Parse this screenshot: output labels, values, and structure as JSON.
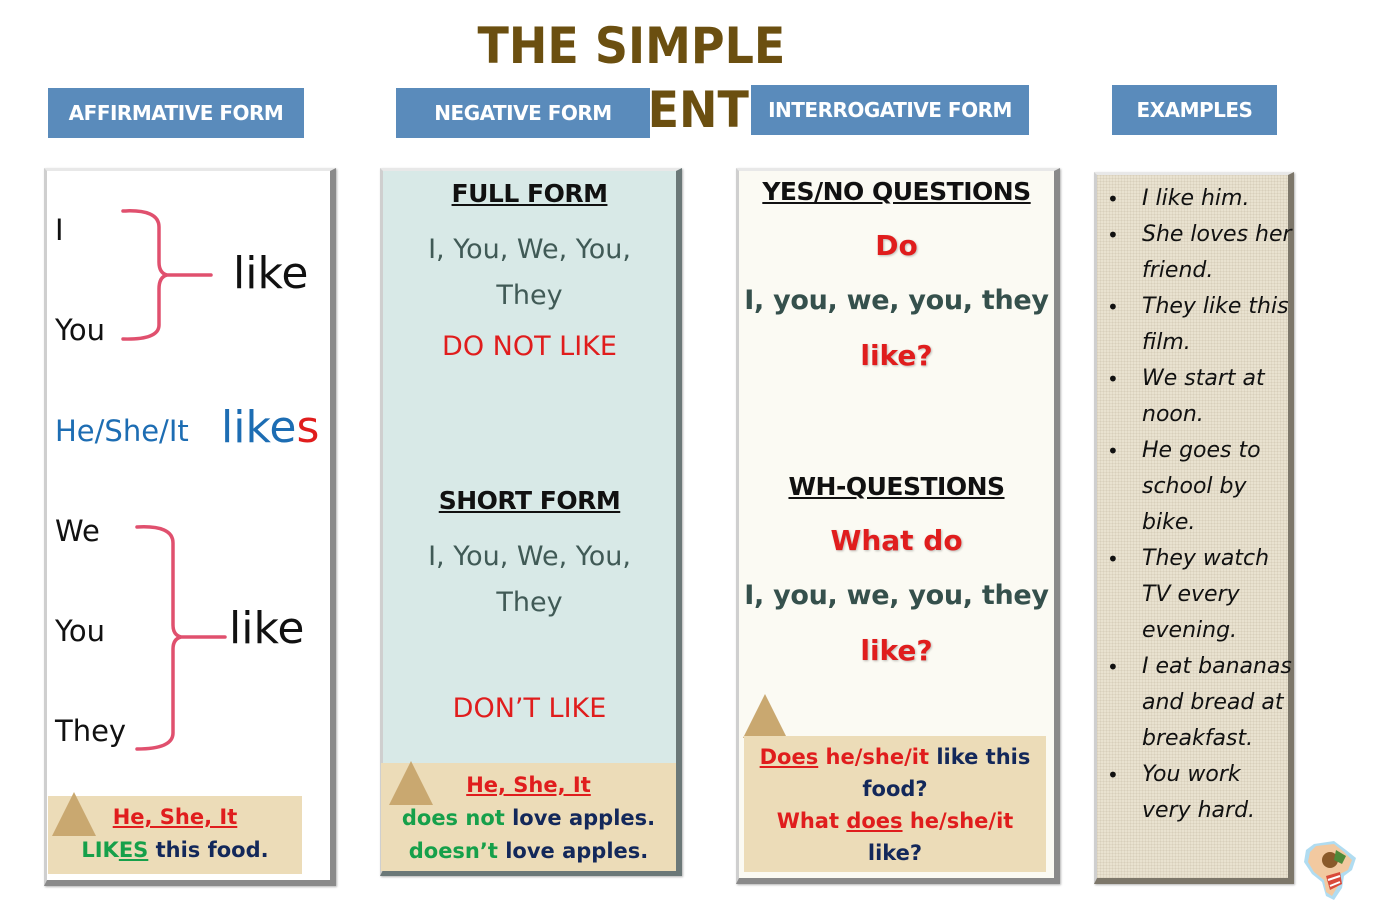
{
  "title": "THE SIMPLE PRESENT",
  "headers": {
    "affirmative": "AFFIRMATIVE FORM",
    "negative": "NEGATIVE FORM",
    "interrogative": "INTERROGATIVE FORM",
    "examples": "EXAMPLES"
  },
  "affirmative": {
    "group1": {
      "pronouns": [
        "I",
        "You"
      ],
      "verb": "like"
    },
    "group2": {
      "pronoun": "He/She/It",
      "verb_stem": "like",
      "verb_suffix": "s"
    },
    "group3": {
      "pronouns": [
        "We",
        "You",
        "They"
      ],
      "verb": "like"
    },
    "note": {
      "subject": "He, She, It",
      "verb_stem": "LIK",
      "verb_suffix": "ES",
      "rest": "this food."
    }
  },
  "negative": {
    "full_form": {
      "heading": "FULL FORM",
      "pronouns_line1": "I, You, We, You,",
      "pronouns_line2": "They",
      "verb": "DO NOT LIKE"
    },
    "short_form": {
      "heading": "SHORT FORM",
      "pronouns_line1": "I, You, We, You,",
      "pronouns_line2": "They",
      "verb": "DON’T LIKE"
    },
    "note": {
      "subject": "He, She, It",
      "line1_aux": "does not",
      "line1_rest": "love apples.",
      "line2_aux": "doesn’t",
      "line2_rest": "love apples."
    }
  },
  "interrogative": {
    "yes_no": {
      "heading": "YES/NO QUESTIONS",
      "aux": "Do",
      "pronouns": "I, you, we, you, they",
      "verb": "like?"
    },
    "wh": {
      "heading": "WH-QUESTIONS",
      "aux": "What do",
      "pronouns": "I, you, we, you, they",
      "verb": "like?"
    },
    "note": {
      "line1_aux": "Does",
      "line1_subject": "he/she/it",
      "line1_rest": "like this",
      "line2": "food?",
      "line3_wh": "What",
      "line3_aux": "does",
      "line3_subject": "he/she/it",
      "line4": "like?"
    }
  },
  "examples": {
    "bullet": "•",
    "items": [
      "I like him.",
      "She loves her friend.",
      "They like this film.",
      "We start at noon.",
      "He goes to school by bike.",
      "They watch TV every evening.",
      "I eat bananas and bread at breakfast.",
      "You work very hard."
    ]
  },
  "colors": {
    "title": "#6b4f10",
    "header_bg": "#5a8bbb",
    "brace": "#e0506e",
    "red": "#e01d1d",
    "blue": "#1d6db3",
    "green": "#16a04a",
    "navy": "#13285a",
    "note_bg": "#ecdcb8",
    "negative_panel": "#d8e9e7",
    "interrogative_panel": "#fbfaf3"
  }
}
